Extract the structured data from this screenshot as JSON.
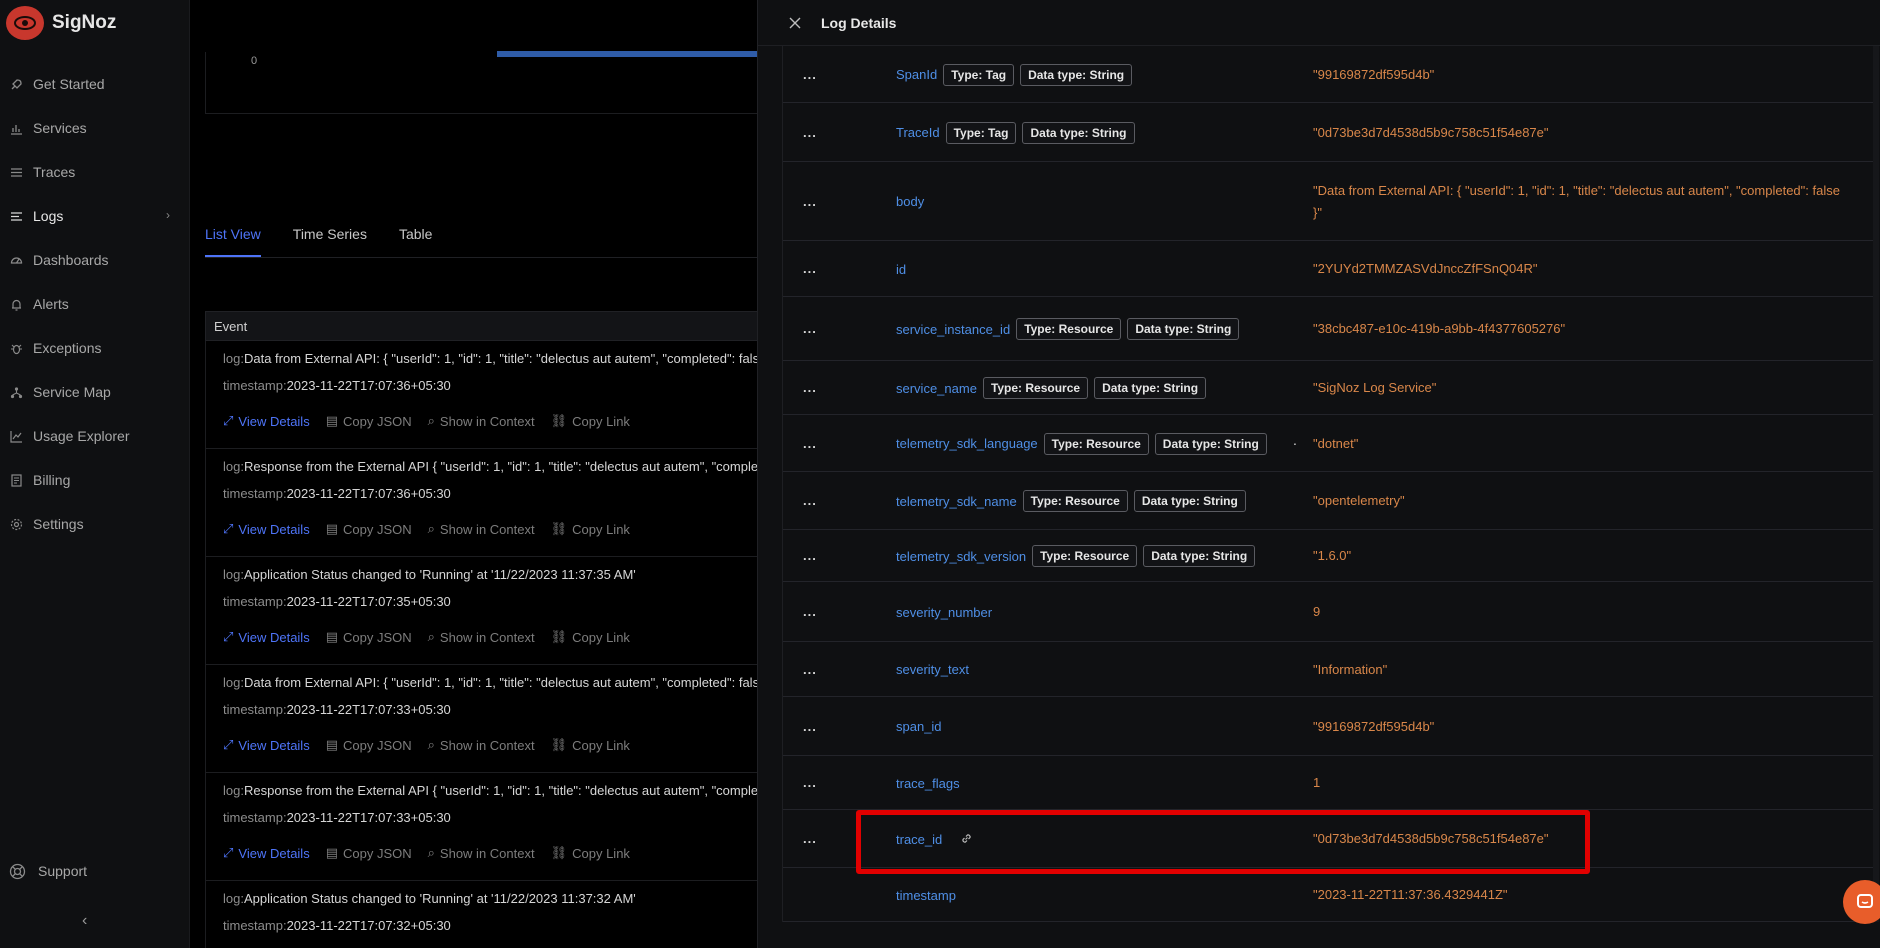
{
  "brand": {
    "name": "SigNoz"
  },
  "sidebar": {
    "items": [
      {
        "label": "Get Started",
        "icon": "rocket-icon"
      },
      {
        "label": "Services",
        "icon": "bar-chart-icon"
      },
      {
        "label": "Traces",
        "icon": "menu-icon"
      },
      {
        "label": "Logs",
        "icon": "logs-icon",
        "active": true
      },
      {
        "label": "Dashboards",
        "icon": "dashboard-icon"
      },
      {
        "label": "Alerts",
        "icon": "bell-icon"
      },
      {
        "label": "Exceptions",
        "icon": "bug-icon"
      },
      {
        "label": "Service Map",
        "icon": "deployment-icon"
      },
      {
        "label": "Usage Explorer",
        "icon": "line-chart-icon"
      },
      {
        "label": "Billing",
        "icon": "billing-icon"
      },
      {
        "label": "Settings",
        "icon": "gear-icon"
      }
    ],
    "support_label": "Support"
  },
  "main": {
    "chart_zero_label": "0",
    "tabs": [
      {
        "label": "List View",
        "active": true
      },
      {
        "label": "Time Series"
      },
      {
        "label": "Table"
      }
    ],
    "event_header": "Event",
    "log_key": "log:",
    "timestamp_key": "timestamp:",
    "actions": {
      "view_details": "View Details",
      "copy_json": "Copy JSON",
      "show_in_context": "Show in Context",
      "copy_link": "Copy Link"
    },
    "events": [
      {
        "log": "Data from External API: { \"userId\": 1, \"id\": 1, \"title\": \"delectus aut autem\", \"completed\": false }",
        "timestamp": "2023-11-22T17:07:36+05:30"
      },
      {
        "log": "Response from the External API { \"userId\": 1, \"id\": 1, \"title\": \"delectus aut autem\", \"completed\": false }",
        "timestamp": "2023-11-22T17:07:36+05:30"
      },
      {
        "log": "Application Status changed to 'Running' at '11/22/2023 11:37:35 AM'",
        "timestamp": "2023-11-22T17:07:35+05:30"
      },
      {
        "log": "Data from External API: { \"userId\": 1, \"id\": 1, \"title\": \"delectus aut autem\", \"completed\": false }",
        "timestamp": "2023-11-22T17:07:33+05:30"
      },
      {
        "log": "Response from the External API { \"userId\": 1, \"id\": 1, \"title\": \"delectus aut autem\", \"completed\": false }",
        "timestamp": "2023-11-22T17:07:33+05:30"
      },
      {
        "log": "Application Status changed to 'Running' at '11/22/2023 11:37:32 AM'",
        "timestamp": "2023-11-22T17:07:32+05:30"
      }
    ]
  },
  "drawer": {
    "title": "Log Details",
    "dots": "...",
    "rows": [
      {
        "key": "SpanId",
        "type": "Type: Tag",
        "dtype": "Data type: String",
        "value": "\"99169872df595d4b\""
      },
      {
        "key": "TraceId",
        "type": "Type: Tag",
        "dtype": "Data type: String",
        "value": "\"0d73be3d7d4538d5b9c758c51f54e87e\""
      },
      {
        "key": "body",
        "value": "\"Data from External API: { \"userId\": 1, \"id\": 1, \"title\": \"delectus aut autem\", \"completed\": false }\""
      },
      {
        "key": "id",
        "value": "\"2YUYd2TMMZASVdJnccZfFSnQ04R\""
      },
      {
        "key": "service_instance_id",
        "type": "Type: Resource",
        "dtype": "Data type: String",
        "value": "\"38cbc487-e10c-419b-a9bb-4f4377605276\""
      },
      {
        "key": "service_name",
        "type": "Type: Resource",
        "dtype": "Data type: String",
        "value": "\"SigNoz Log Service\""
      },
      {
        "key": "telemetry_sdk_language",
        "type": "Type: Resource",
        "dtype": "Data type: String",
        "value": "\"dotnet\""
      },
      {
        "key": "telemetry_sdk_name",
        "type": "Type: Resource",
        "dtype": "Data type: String",
        "value": "\"opentelemetry\""
      },
      {
        "key": "telemetry_sdk_version",
        "type": "Type: Resource",
        "dtype": "Data type: String",
        "value": "\"1.6.0\""
      },
      {
        "key": "severity_number",
        "value": "9"
      },
      {
        "key": "severity_text",
        "value": "\"Information\""
      },
      {
        "key": "span_id",
        "value": "\"99169872df595d4b\""
      },
      {
        "key": "trace_flags",
        "value": "1"
      },
      {
        "key": "trace_id",
        "value": "\"0d73be3d7d4538d5b9c758c51f54e87e\"",
        "link_icon": "link-icon",
        "highlighted": true
      },
      {
        "key": "timestamp",
        "value": "\"2023-11-22T11:37:36.4329441Z\""
      }
    ]
  },
  "colors": {
    "accent": "#4e74f8",
    "key": "#4f8fe6",
    "value": "#d9874a",
    "highlight": "#e10000",
    "brand": "#c8372d"
  }
}
